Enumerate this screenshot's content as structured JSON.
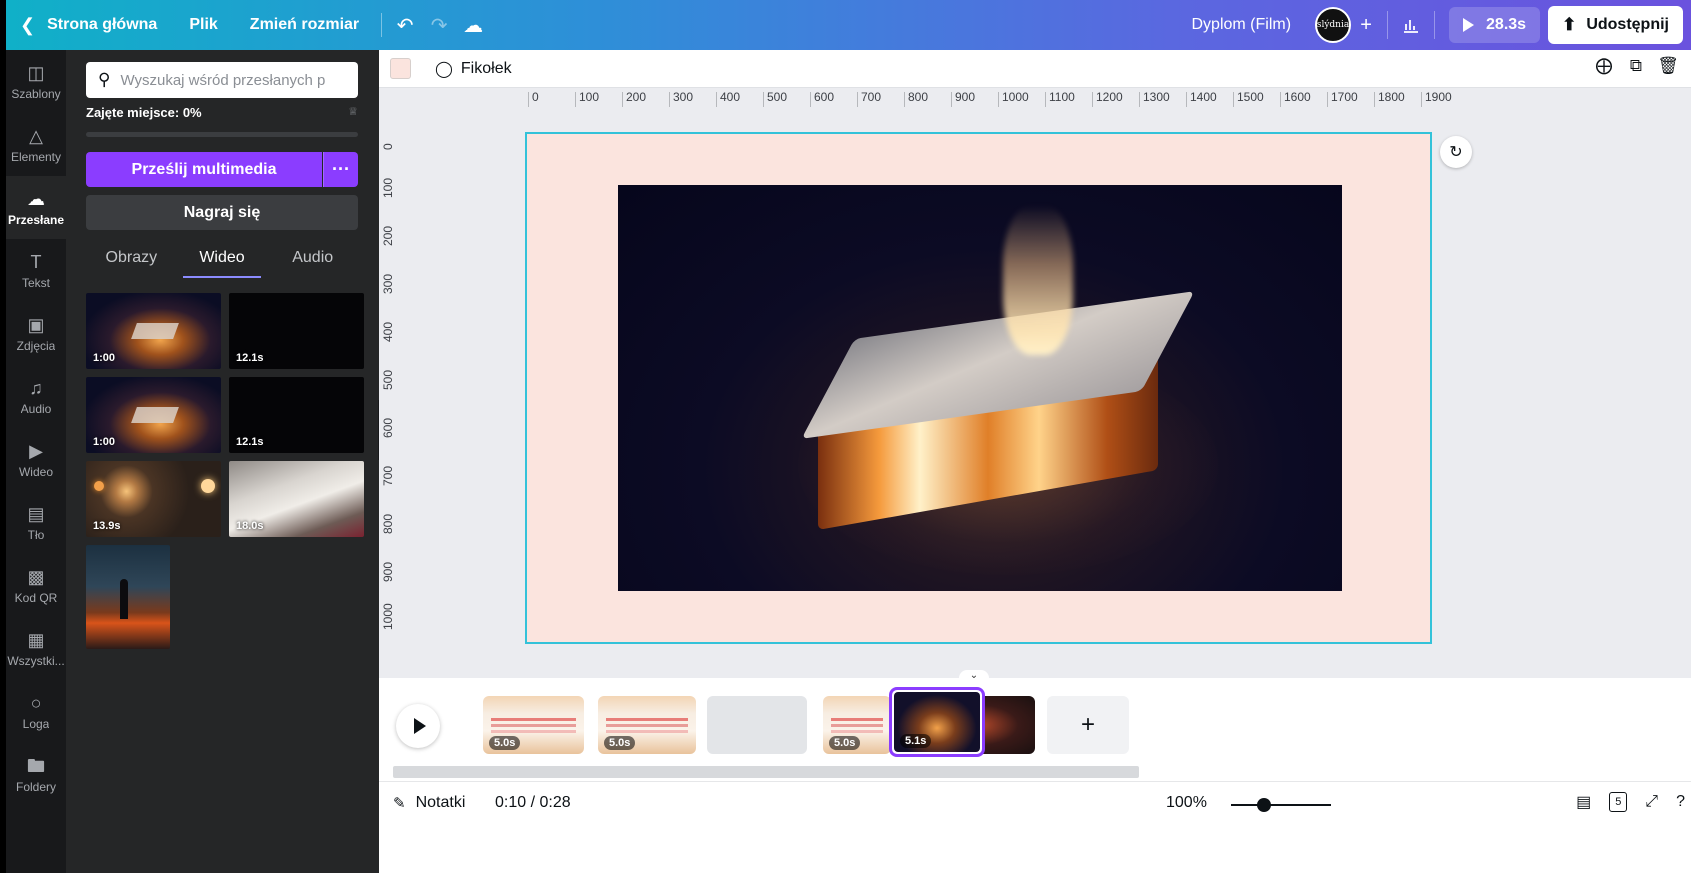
{
  "topbar": {
    "home": "Strona główna",
    "file": "Plik",
    "resize": "Zmień rozmiar",
    "doc_title": "Dyplom (Film)",
    "play_duration": "28.3s",
    "share": "Udostępnij",
    "avatar_text": "slýdnia"
  },
  "rail": [
    {
      "label": "Szablony",
      "icon": "template-icon"
    },
    {
      "label": "Elementy",
      "icon": "elements-icon"
    },
    {
      "label": "Przesłane",
      "icon": "upload-cloud-icon"
    },
    {
      "label": "Tekst",
      "icon": "text-icon"
    },
    {
      "label": "Zdjęcia",
      "icon": "photos-icon"
    },
    {
      "label": "Audio",
      "icon": "music-icon"
    },
    {
      "label": "Wideo",
      "icon": "video-icon"
    },
    {
      "label": "Tło",
      "icon": "background-icon"
    },
    {
      "label": "Kod QR",
      "icon": "qr-code-icon"
    },
    {
      "label": "Wszystki...",
      "icon": "apps-icon"
    },
    {
      "label": "Loga",
      "icon": "logo-icon"
    },
    {
      "label": "Foldery",
      "icon": "folder-icon"
    }
  ],
  "panel": {
    "search_placeholder": "Wyszukaj wśród przesłanych p",
    "usage": "Zajęte miejsce: 0%",
    "usage_fraction": 0,
    "upload": "Prześlij multimedia",
    "more": "···",
    "record": "Nagraj się",
    "tabs": [
      "Obrazy",
      "Wideo",
      "Audio"
    ],
    "active_tab": "Wideo",
    "videos": [
      {
        "duration": "1:00",
        "kind": "book"
      },
      {
        "duration": "12.1s",
        "kind": "black"
      },
      {
        "duration": "1:00",
        "kind": "book"
      },
      {
        "duration": "12.1s",
        "kind": "black"
      },
      {
        "duration": "13.9s",
        "kind": "bokeh"
      },
      {
        "duration": "18.0s",
        "kind": "bible"
      },
      {
        "duration": "",
        "kind": "sunset"
      }
    ]
  },
  "editor": {
    "animation": "Fikołek",
    "background_color": "#fbe4de",
    "ruler_h": [
      "0",
      "100",
      "200",
      "300",
      "400",
      "500",
      "600",
      "700",
      "800",
      "900",
      "1000",
      "1100",
      "1200",
      "1300",
      "1400",
      "1500",
      "1600",
      "1700",
      "1800",
      "1900"
    ],
    "ruler_v": [
      "0",
      "100",
      "200",
      "300",
      "400",
      "500",
      "600",
      "700",
      "800",
      "900",
      "1000"
    ]
  },
  "timeline": {
    "clips": [
      {
        "duration": "5.0s",
        "kind": "diploma"
      },
      {
        "duration": "5.0s",
        "kind": "diploma"
      },
      {
        "duration": "",
        "kind": "grey"
      },
      {
        "duration": "5.0s",
        "kind": "diploma"
      },
      {
        "duration": "5.1s",
        "kind": "book",
        "selected": true
      },
      {
        "duration": "",
        "kind": "red"
      }
    ],
    "add": "+"
  },
  "status": {
    "notes": "Notatki",
    "timecode": "0:10 / 0:28",
    "zoom": "100%",
    "page_count": "5",
    "help": "?"
  },
  "colors": {
    "accent": "#8b3dff",
    "selection": "#33c2d9"
  }
}
